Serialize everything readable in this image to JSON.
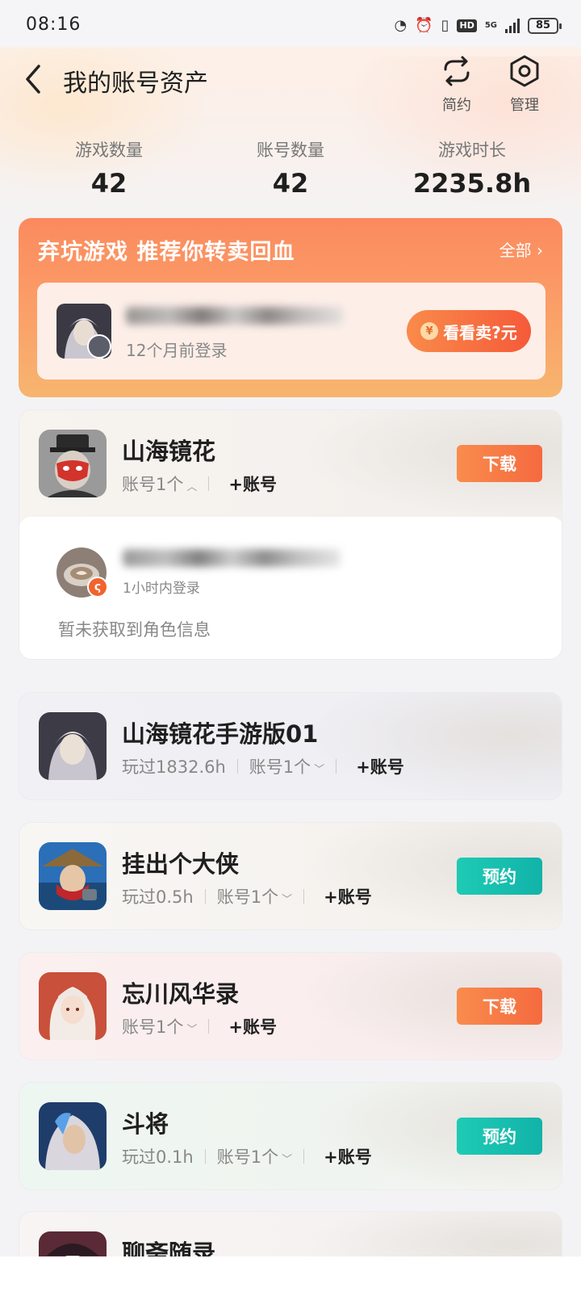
{
  "status_bar": {
    "time": "08:16",
    "network": "5G",
    "hd": "HD",
    "battery": "85"
  },
  "header": {
    "title": "我的账号资产",
    "actions": [
      {
        "label": "简约"
      },
      {
        "label": "管理"
      }
    ]
  },
  "stats": [
    {
      "label": "游戏数量",
      "value": "42"
    },
    {
      "label": "账号数量",
      "value": "42"
    },
    {
      "label": "游戏时长",
      "value": "2235.8h"
    }
  ],
  "promo": {
    "title": "弃坑游戏 推荐你转卖回血",
    "all_label": "全部",
    "card": {
      "login_text": "12个月前登录",
      "sell_label": "看看卖?元",
      "sell_icon_text": "¥"
    }
  },
  "games": [
    {
      "name": "山海镜花",
      "meta": {
        "accounts": "账号1个",
        "add": "+账号"
      },
      "button": "下载",
      "expanded_account": {
        "login_text": "1小时内登录",
        "role_text": "暂未获取到角色信息",
        "badge": "ς"
      }
    },
    {
      "name": "山海镜花手游版01",
      "meta": {
        "played": "玩过1832.6h",
        "accounts": "账号1个",
        "add": "+账号"
      }
    },
    {
      "name": "挂出个大侠",
      "meta": {
        "played": "玩过0.5h",
        "accounts": "账号1个",
        "add": "+账号"
      },
      "button": "预约"
    },
    {
      "name": "忘川风华录",
      "meta": {
        "accounts": "账号1个",
        "add": "+账号"
      },
      "button": "下载"
    },
    {
      "name": "斗将",
      "meta": {
        "played": "玩过0.1h",
        "accounts": "账号1个",
        "add": "+账号"
      },
      "button": "预约"
    },
    {
      "name": "聊斋随录"
    }
  ],
  "colors": {
    "accent_orange": "#f56a3f",
    "accent_teal": "#12b3a9",
    "promo_bg": "#fb8a5e"
  }
}
